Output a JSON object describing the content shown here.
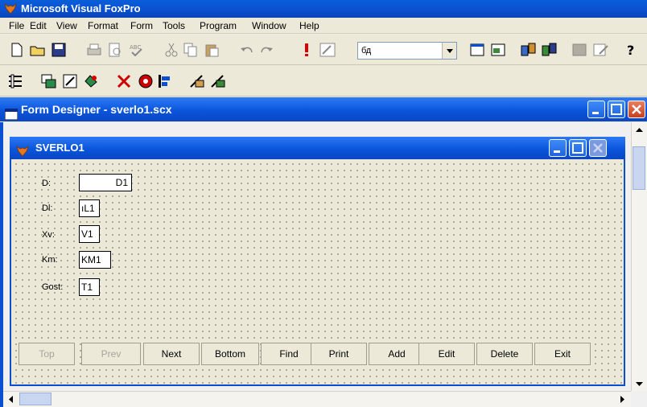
{
  "app": {
    "title": "Microsoft Visual FoxPro"
  },
  "menu": [
    "File",
    "Edit",
    "View",
    "Format",
    "Form",
    "Tools",
    "Program",
    "Window",
    "Help"
  ],
  "toolbar": {
    "database_combo_value": "бд"
  },
  "designer": {
    "title": "Form Designer - sverlo1.scx"
  },
  "form": {
    "title": "SVERLO1",
    "fields": [
      {
        "label": "D:",
        "value": "D1"
      },
      {
        "label": "Dl:",
        "value": "ıL1"
      },
      {
        "label": "Xv:",
        "value": "V1"
      },
      {
        "label": "Km:",
        "value": "KM1"
      },
      {
        "label": "Gost:",
        "value": "T1"
      }
    ],
    "buttons": [
      {
        "label": "Top",
        "enabled": false
      },
      {
        "label": "Prev",
        "enabled": false
      },
      {
        "label": "Next",
        "enabled": true
      },
      {
        "label": "Bottom",
        "enabled": true
      },
      {
        "label": "Find",
        "enabled": true
      },
      {
        "label": "Print",
        "enabled": true
      },
      {
        "label": "Add",
        "enabled": true
      },
      {
        "label": "Edit",
        "enabled": true
      },
      {
        "label": "Delete",
        "enabled": true
      },
      {
        "label": "Exit",
        "enabled": true
      }
    ]
  },
  "colors": {
    "titlebar": "#0a4fcf",
    "close": "#c8401f"
  }
}
